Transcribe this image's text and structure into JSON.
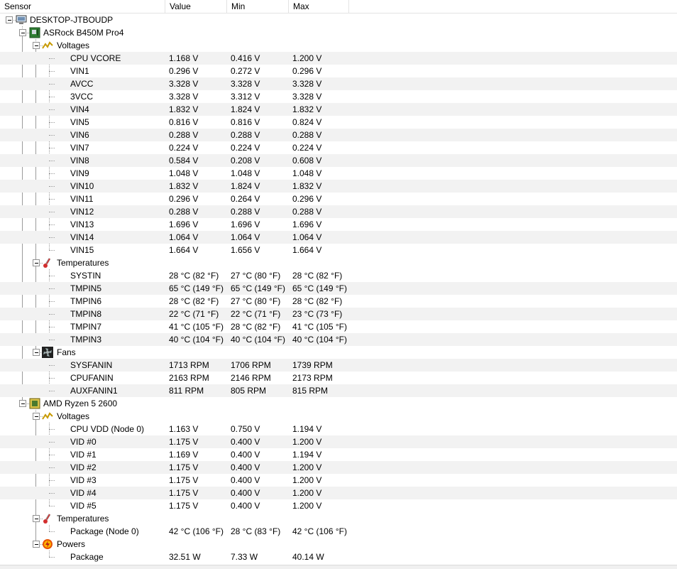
{
  "window": {
    "title": ""
  },
  "columns": [
    "Sensor",
    "Value",
    "Min",
    "Max"
  ],
  "rows": [
    {
      "level": 0,
      "type": "computer",
      "label": "DESKTOP-JTBOUDP",
      "value": "",
      "min": "",
      "max": "",
      "icon": "computer-icon"
    },
    {
      "level": 1,
      "type": "hardware",
      "label": "ASRock B450M Pro4",
      "value": "",
      "min": "",
      "max": "",
      "icon": "motherboard-icon"
    },
    {
      "level": 2,
      "type": "group",
      "label": "Voltages",
      "value": "",
      "min": "",
      "max": "",
      "icon": "voltage-icon"
    },
    {
      "level": 3,
      "type": "sensor",
      "label": "CPU VCORE",
      "value": "1.168 V",
      "min": "0.416 V",
      "max": "1.200 V"
    },
    {
      "level": 3,
      "type": "sensor",
      "label": "VIN1",
      "value": "0.296 V",
      "min": "0.272 V",
      "max": "0.296 V"
    },
    {
      "level": 3,
      "type": "sensor",
      "label": "AVCC",
      "value": "3.328 V",
      "min": "3.328 V",
      "max": "3.328 V"
    },
    {
      "level": 3,
      "type": "sensor",
      "label": "3VCC",
      "value": "3.328 V",
      "min": "3.312 V",
      "max": "3.328 V"
    },
    {
      "level": 3,
      "type": "sensor",
      "label": "VIN4",
      "value": "1.832 V",
      "min": "1.824 V",
      "max": "1.832 V"
    },
    {
      "level": 3,
      "type": "sensor",
      "label": "VIN5",
      "value": "0.816 V",
      "min": "0.816 V",
      "max": "0.824 V"
    },
    {
      "level": 3,
      "type": "sensor",
      "label": "VIN6",
      "value": "0.288 V",
      "min": "0.288 V",
      "max": "0.288 V"
    },
    {
      "level": 3,
      "type": "sensor",
      "label": "VIN7",
      "value": "0.224 V",
      "min": "0.224 V",
      "max": "0.224 V"
    },
    {
      "level": 3,
      "type": "sensor",
      "label": "VIN8",
      "value": "0.584 V",
      "min": "0.208 V",
      "max": "0.608 V"
    },
    {
      "level": 3,
      "type": "sensor",
      "label": "VIN9",
      "value": "1.048 V",
      "min": "1.048 V",
      "max": "1.048 V"
    },
    {
      "level": 3,
      "type": "sensor",
      "label": "VIN10",
      "value": "1.832 V",
      "min": "1.824 V",
      "max": "1.832 V"
    },
    {
      "level": 3,
      "type": "sensor",
      "label": "VIN11",
      "value": "0.296 V",
      "min": "0.264 V",
      "max": "0.296 V"
    },
    {
      "level": 3,
      "type": "sensor",
      "label": "VIN12",
      "value": "0.288 V",
      "min": "0.288 V",
      "max": "0.288 V"
    },
    {
      "level": 3,
      "type": "sensor",
      "label": "VIN13",
      "value": "1.696 V",
      "min": "1.696 V",
      "max": "1.696 V"
    },
    {
      "level": 3,
      "type": "sensor",
      "label": "VIN14",
      "value": "1.064 V",
      "min": "1.064 V",
      "max": "1.064 V"
    },
    {
      "level": 3,
      "type": "sensor",
      "label": "VIN15",
      "value": "1.664 V",
      "min": "1.656 V",
      "max": "1.664 V"
    },
    {
      "level": 2,
      "type": "group",
      "label": "Temperatures",
      "value": "",
      "min": "",
      "max": "",
      "icon": "thermometer-icon"
    },
    {
      "level": 3,
      "type": "sensor",
      "label": "SYSTIN",
      "value": "28 °C  (82 °F)",
      "min": "27 °C  (80 °F)",
      "max": "28 °C  (82 °F)"
    },
    {
      "level": 3,
      "type": "sensor",
      "label": "TMPIN5",
      "value": "65 °C  (149 °F)",
      "min": "65 °C  (149 °F)",
      "max": "65 °C  (149 °F)"
    },
    {
      "level": 3,
      "type": "sensor",
      "label": "TMPIN6",
      "value": "28 °C  (82 °F)",
      "min": "27 °C  (80 °F)",
      "max": "28 °C  (82 °F)"
    },
    {
      "level": 3,
      "type": "sensor",
      "label": "TMPIN8",
      "value": "22 °C  (71 °F)",
      "min": "22 °C  (71 °F)",
      "max": "23 °C  (73 °F)"
    },
    {
      "level": 3,
      "type": "sensor",
      "label": "TMPIN7",
      "value": "41 °C  (105 °F)",
      "min": "28 °C  (82 °F)",
      "max": "41 °C  (105 °F)"
    },
    {
      "level": 3,
      "type": "sensor",
      "label": "TMPIN3",
      "value": "40 °C  (104 °F)",
      "min": "40 °C  (104 °F)",
      "max": "40 °C  (104 °F)"
    },
    {
      "level": 2,
      "type": "group",
      "label": "Fans",
      "value": "",
      "min": "",
      "max": "",
      "icon": "fan-icon"
    },
    {
      "level": 3,
      "type": "sensor",
      "label": "SYSFANIN",
      "value": "1713 RPM",
      "min": "1706 RPM",
      "max": "1739 RPM"
    },
    {
      "level": 3,
      "type": "sensor",
      "label": "CPUFANIN",
      "value": "2163 RPM",
      "min": "2146 RPM",
      "max": "2173 RPM"
    },
    {
      "level": 3,
      "type": "sensor",
      "label": "AUXFANIN1",
      "value": "811 RPM",
      "min": "805 RPM",
      "max": "815 RPM"
    },
    {
      "level": 1,
      "type": "hardware",
      "label": "AMD Ryzen 5 2600",
      "value": "",
      "min": "",
      "max": "",
      "icon": "cpu-icon"
    },
    {
      "level": 2,
      "type": "group",
      "label": "Voltages",
      "value": "",
      "min": "",
      "max": "",
      "icon": "voltage-icon"
    },
    {
      "level": 3,
      "type": "sensor",
      "label": "CPU VDD (Node 0)",
      "value": "1.163 V",
      "min": "0.750 V",
      "max": "1.194 V"
    },
    {
      "level": 3,
      "type": "sensor",
      "label": "VID #0",
      "value": "1.175 V",
      "min": "0.400 V",
      "max": "1.200 V"
    },
    {
      "level": 3,
      "type": "sensor",
      "label": "VID #1",
      "value": "1.169 V",
      "min": "0.400 V",
      "max": "1.194 V"
    },
    {
      "level": 3,
      "type": "sensor",
      "label": "VID #2",
      "value": "1.175 V",
      "min": "0.400 V",
      "max": "1.200 V"
    },
    {
      "level": 3,
      "type": "sensor",
      "label": "VID #3",
      "value": "1.175 V",
      "min": "0.400 V",
      "max": "1.200 V"
    },
    {
      "level": 3,
      "type": "sensor",
      "label": "VID #4",
      "value": "1.175 V",
      "min": "0.400 V",
      "max": "1.200 V"
    },
    {
      "level": 3,
      "type": "sensor",
      "label": "VID #5",
      "value": "1.175 V",
      "min": "0.400 V",
      "max": "1.200 V"
    },
    {
      "level": 2,
      "type": "group",
      "label": "Temperatures",
      "value": "",
      "min": "",
      "max": "",
      "icon": "thermometer-icon"
    },
    {
      "level": 3,
      "type": "sensor",
      "label": "Package (Node 0)",
      "value": "42 °C  (106 °F)",
      "min": "28 °C  (83 °F)",
      "max": "42 °C  (106 °F)"
    },
    {
      "level": 2,
      "type": "group",
      "label": "Powers",
      "value": "",
      "min": "",
      "max": "",
      "icon": "power-icon"
    },
    {
      "level": 3,
      "type": "sensor",
      "label": "Package",
      "value": "32.51 W",
      "min": "7.33 W",
      "max": "40.14 W"
    }
  ]
}
